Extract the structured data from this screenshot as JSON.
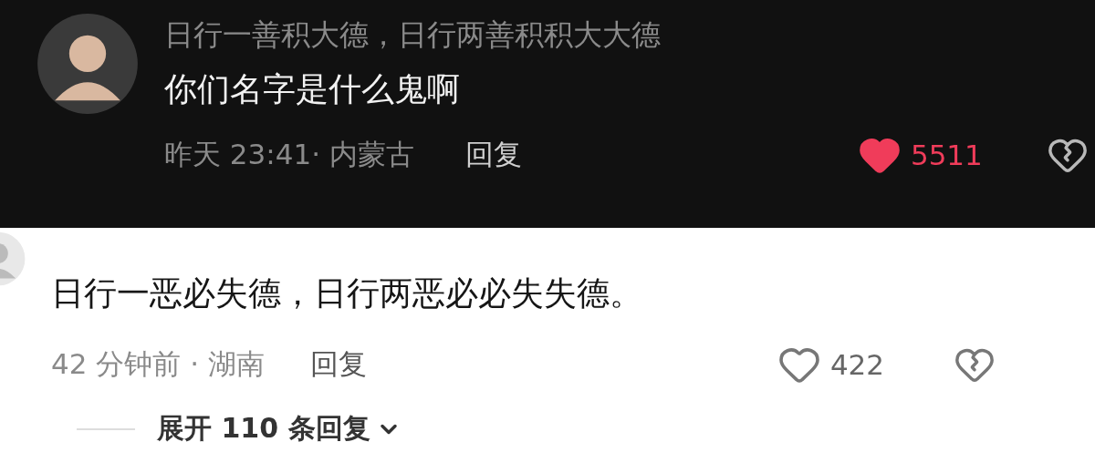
{
  "comments": [
    {
      "kind": "dark",
      "username": "日行一善积大德，日行两善积积大大德",
      "text": "你们名字是什么鬼啊",
      "time": "昨天 23:41· 内蒙古",
      "reply": "回复",
      "liked": true,
      "likes": "5511"
    },
    {
      "kind": "light",
      "text": "日行一恶必失德，日行两恶必必失失德。",
      "time": "42 分钟前 · 湖南",
      "reply": "回复",
      "liked": false,
      "likes": "422",
      "expand": "展开 110 条回复"
    }
  ]
}
